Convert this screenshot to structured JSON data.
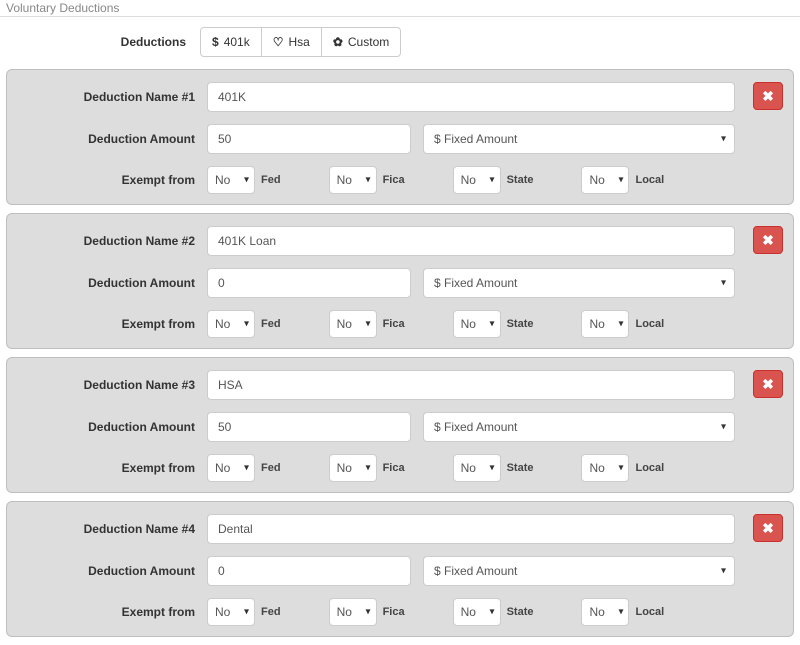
{
  "section_title": "Voluntary Deductions",
  "toolbar": {
    "label": "Deductions",
    "btn_401k": "401k",
    "btn_hsa": "Hsa",
    "btn_custom": "Custom"
  },
  "icons": {
    "dollar": "$",
    "heart": "♡",
    "gear": "✿",
    "close": "✖"
  },
  "labels": {
    "name_prefix": "Deduction Name #",
    "amount": "Deduction Amount",
    "exempt": "Exempt from",
    "fed": "Fed",
    "fica": "Fica",
    "state": "State",
    "local": "Local"
  },
  "amount_type_selected": "$ Fixed Amount",
  "exempt_default": "No",
  "deductions": [
    {
      "idx": "1",
      "name": "401K",
      "amount": "50"
    },
    {
      "idx": "2",
      "name": "401K Loan",
      "amount": "0"
    },
    {
      "idx": "3",
      "name": "HSA",
      "amount": "50"
    },
    {
      "idx": "4",
      "name": "Dental",
      "amount": "0"
    }
  ]
}
